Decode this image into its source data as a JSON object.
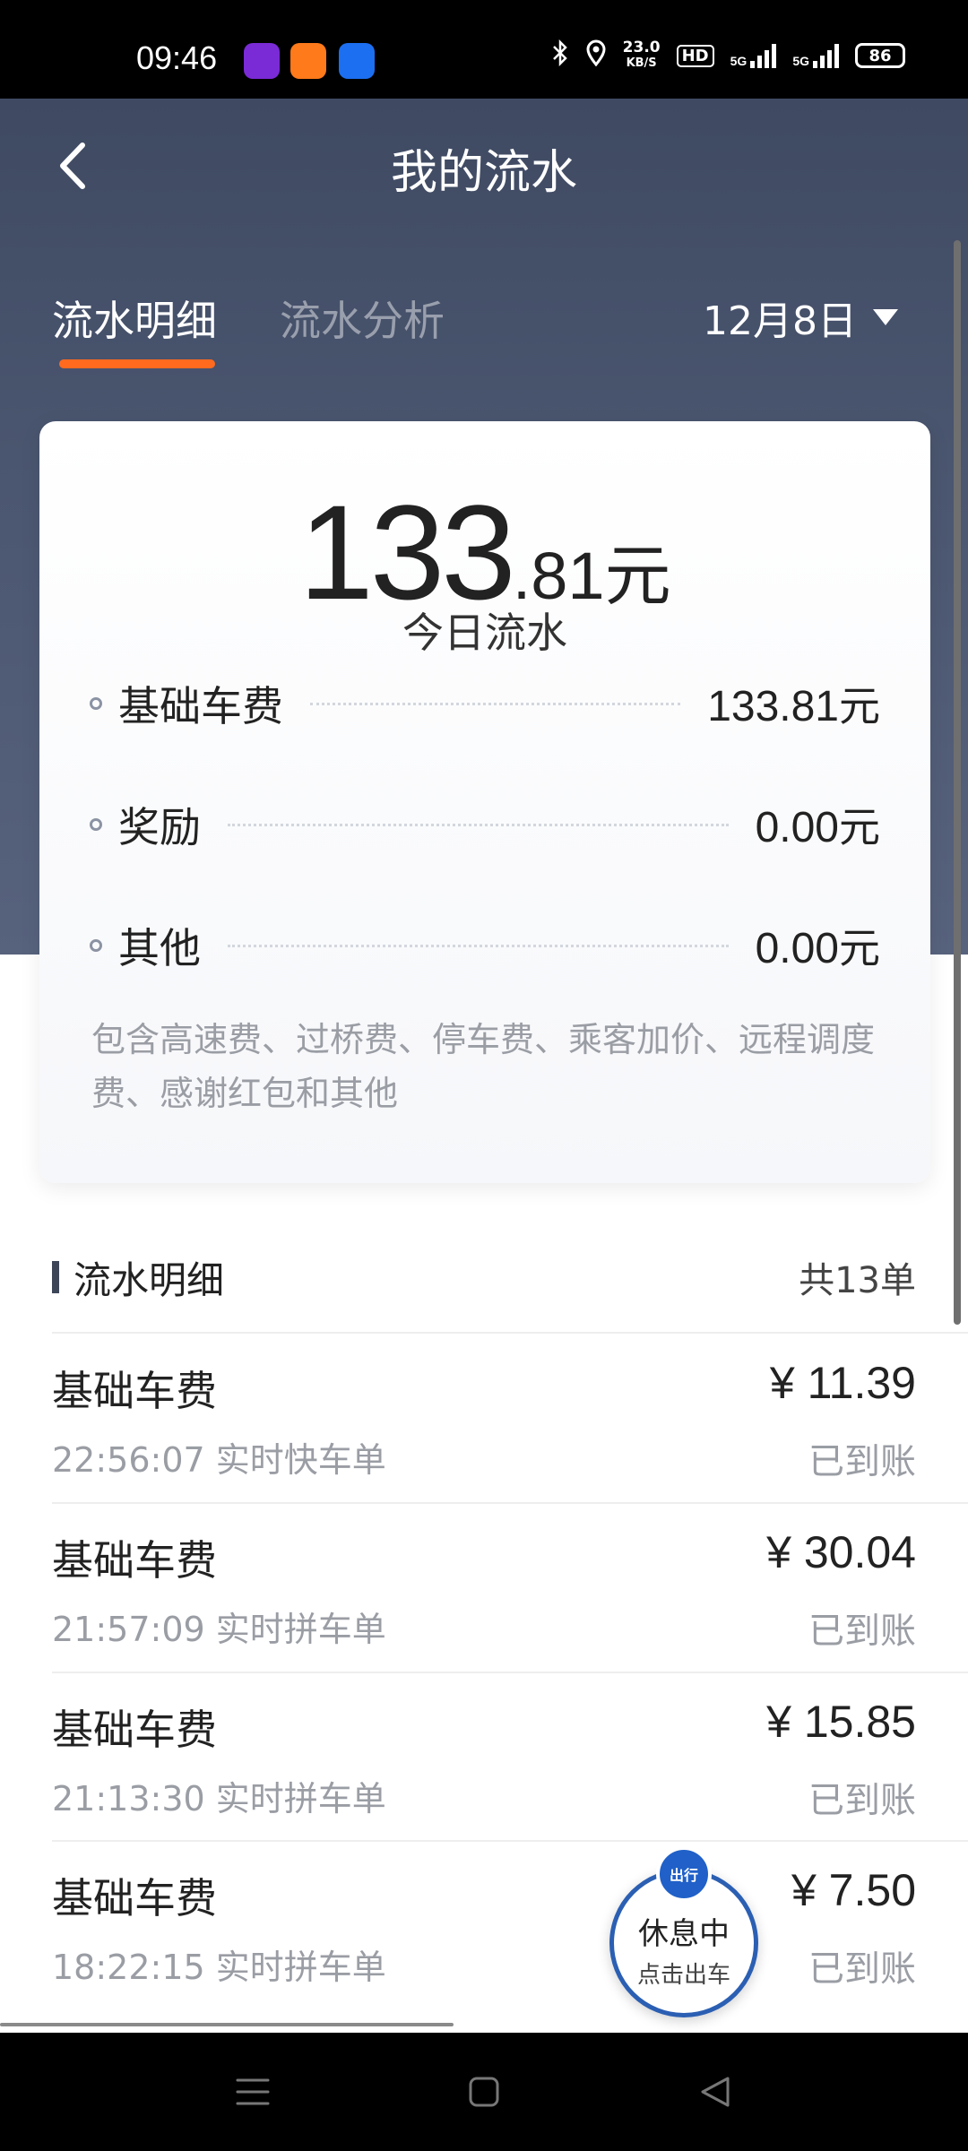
{
  "status_bar": {
    "time": "09:46",
    "network_speed_value": "23.0",
    "network_speed_unit": "KB/S",
    "hd_badge": "HD",
    "signal1": "5G",
    "signal2": "5G",
    "battery": "86"
  },
  "header": {
    "title": "我的流水",
    "tabs": [
      {
        "label": "流水明细",
        "active": true
      },
      {
        "label": "流水分析",
        "active": false
      }
    ],
    "date": "12月8日"
  },
  "summary": {
    "amount_int": "133",
    "amount_dec": ".81",
    "amount_unit": "元",
    "amount_label": "今日流水",
    "items": [
      {
        "label": "基础车费",
        "value": "133.81",
        "unit": "元"
      },
      {
        "label": "奖励",
        "value": "0.00",
        "unit": "元"
      },
      {
        "label": "其他",
        "value": "0.00",
        "unit": "元"
      }
    ],
    "note": "包含高速费、过桥费、停车费、乘客加价、远程调度费、感谢红包和其他"
  },
  "detail": {
    "title": "流水明细",
    "count": "共13单",
    "rows": [
      {
        "type": "基础车费",
        "meta": "22:56:07 实时快车单",
        "amount": "¥ 11.39",
        "status": "已到账"
      },
      {
        "type": "基础车费",
        "meta": "21:57:09 实时拼车单",
        "amount": "¥ 30.04",
        "status": "已到账"
      },
      {
        "type": "基础车费",
        "meta": "21:13:30 实时拼车单",
        "amount": "¥ 15.85",
        "status": "已到账"
      },
      {
        "type": "基础车费",
        "meta": "18:22:15 实时拼车单",
        "amount": "¥ 7.50",
        "status": "已到账"
      }
    ]
  },
  "rest_button": {
    "logo": "出行",
    "title": "休息中",
    "subtitle": "点击出车"
  },
  "icons": {
    "back": "chevron-left-icon",
    "dropdown": "triangle-down-icon",
    "nav": [
      "menu-icon",
      "home-square-icon",
      "back-triangle-icon"
    ]
  },
  "colors": {
    "header_bg": "#4b5670",
    "tab_indicator": "#ff6a1e",
    "rest_button_border": "#2b5fb3"
  }
}
